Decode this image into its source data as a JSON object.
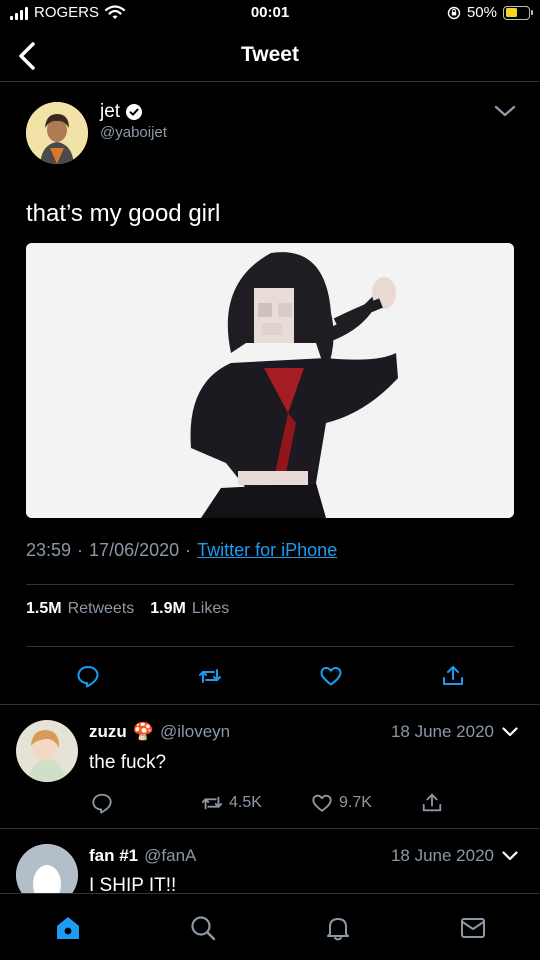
{
  "status_bar": {
    "carrier": "ROGERS",
    "time": "00:01",
    "battery": "50%",
    "battery_level": 0.5,
    "battery_color": "#f5d422"
  },
  "nav": {
    "title": "Tweet",
    "back_icon": "back-arrow-icon"
  },
  "tweet": {
    "author_name": "jet",
    "author_handle": "@yaboijet",
    "text": "that’s my good girl",
    "time": "23:59",
    "date": "17/06/2020",
    "source": "Twitter for iPhone",
    "retweets_count": "1.5M",
    "retweets_label": "Retweets",
    "likes_count": "1.9M",
    "likes_label": "Likes",
    "media": "image"
  },
  "replies": [
    {
      "name": "zuzu",
      "emoji": "🍄",
      "handle": "@iloveyn",
      "date": "18 June 2020",
      "text": "the fuck?",
      "retweets": "4.5K",
      "likes": "9.7K"
    },
    {
      "name": "fan #1",
      "handle": "@fanA",
      "date": "18 June 2020",
      "text": "I SHIP IT!!"
    }
  ],
  "tabbar": {
    "items": [
      "home-icon",
      "search-icon",
      "notifications-icon",
      "messages-icon"
    ],
    "active": "home-icon"
  },
  "colors": {
    "accent": "#1d9bf0",
    "background": "#000000",
    "muted": "#8b98a5",
    "divider": "#2f3336"
  }
}
